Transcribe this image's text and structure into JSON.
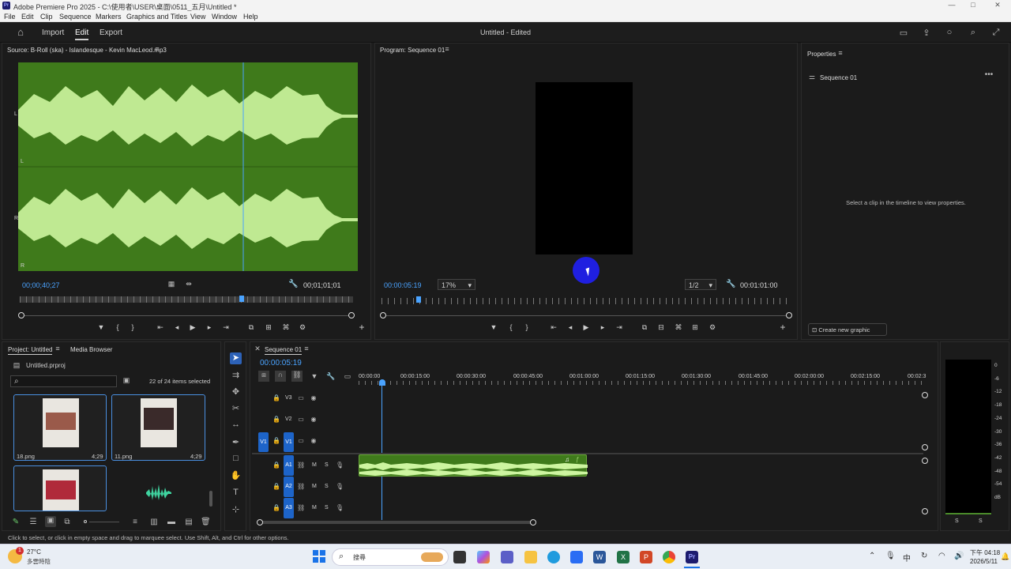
{
  "window": {
    "title": "Adobe Premiere Pro 2025 - C:\\使用者\\USER\\桌面\\0511_五月\\Untitled *",
    "logo": "Pr",
    "controls": {
      "minimize": "—",
      "maximize": "□",
      "close": "✕"
    }
  },
  "menu": [
    "File",
    "Edit",
    "Clip",
    "Sequence",
    "Markers",
    "Graphics and Titles",
    "View",
    "Window",
    "Help"
  ],
  "header": {
    "tabs": [
      "Import",
      "Edit",
      "Export"
    ],
    "active_tab": "Edit",
    "doc_title": "Untitled - Edited"
  },
  "source": {
    "title": "Source: B-Roll (ska) - Islandesque - Kevin MacLeod.mp3",
    "channel_labels": [
      "L",
      "L",
      "R",
      "R"
    ],
    "timecode_in": "00;00;40;27",
    "timecode_out": "00;01;01;01"
  },
  "program": {
    "title": "Program: Sequence 01",
    "timecode": "00:00:05:19",
    "zoom": "17%",
    "resolution": "1/2",
    "duration": "00:01:01:00"
  },
  "properties": {
    "title": "Properties",
    "item": "Sequence 01",
    "hint": "Select a clip in the timeline to view properties.",
    "create_button": "Create new graphic"
  },
  "project": {
    "tabs": [
      "Project: Untitled",
      "Media Browser"
    ],
    "file": "Untitled.prproj",
    "selection": "22 of 24 items selected",
    "items": [
      {
        "name": "18.png",
        "duration": "4;29"
      },
      {
        "name": "11.png",
        "duration": "4;29"
      },
      {
        "name": "",
        "duration": ""
      },
      {
        "name": "",
        "duration": ""
      }
    ]
  },
  "timeline": {
    "title": "Sequence 01",
    "timecode": "00:00:05:19",
    "ruler": [
      "00:00:00",
      "00:00:15:00",
      "00:00:30:00",
      "00:00:45:00",
      "00:01:00:00",
      "00:01:15:00",
      "00:01:30:00",
      "00:01:45:00",
      "00:02:00:00",
      "00:02:15:00",
      "00:02:3"
    ],
    "video_tracks": [
      "V3",
      "V2",
      "V1"
    ],
    "audio_tracks": [
      "A1",
      "A2",
      "A3"
    ],
    "source_patch": "V1",
    "mute": "M",
    "solo": "S"
  },
  "meters": {
    "scale": [
      "0",
      "-6",
      "-12",
      "-18",
      "-24",
      "-30",
      "-36",
      "-42",
      "-48",
      "-54",
      "dB"
    ],
    "solo": [
      "S",
      "S"
    ]
  },
  "status_bar": "Click to select, or click in empty space and drag to marquee select. Use Shift, Alt, and Ctrl for other options.",
  "taskbar": {
    "weather_temp": "27°C",
    "weather_desc": "多雲時陰",
    "notification_count": "1",
    "search_label": "搜尋",
    "time": "下午 04:18",
    "date": "2026/5/11"
  },
  "colors": {
    "accent": "#1d64c9",
    "waveform_bg": "#3f7a1b",
    "waveform": "#cdf5a0",
    "timecode": "#4aa3ff"
  }
}
